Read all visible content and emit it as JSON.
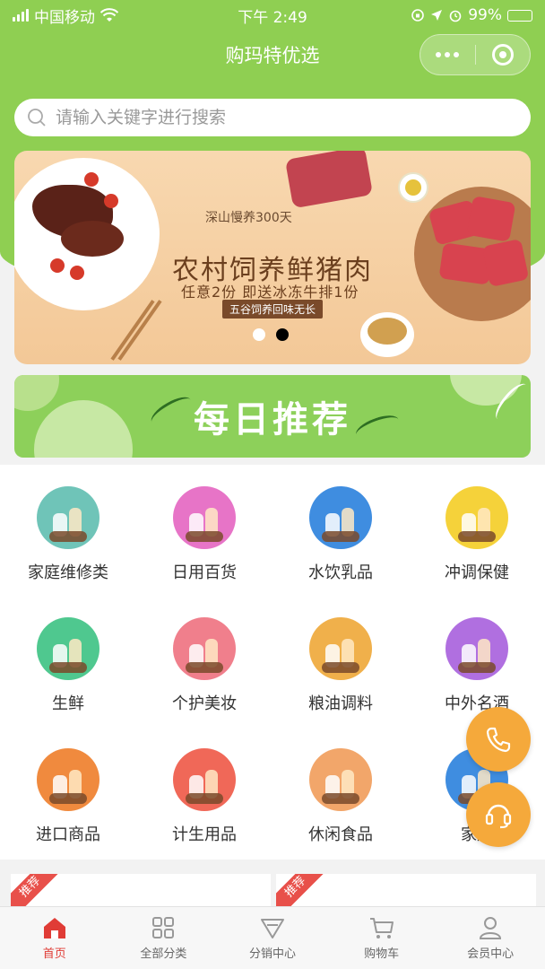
{
  "status_bar": {
    "carrier": "中国移动",
    "time": "下午 2:49",
    "battery": "99%"
  },
  "header": {
    "title": "购玛特优选"
  },
  "search": {
    "placeholder": "请输入关键字进行搜索"
  },
  "banner": {
    "subtitle": "深山慢养300天",
    "title": "农村饲养鲜猪肉",
    "offer": "任意2份 即送冰冻牛排1份",
    "tag": "五谷饲养回味无长",
    "active_slide": 2,
    "slide_count": 2
  },
  "daily": {
    "title": "每日推荐"
  },
  "categories": [
    {
      "label": "家庭维修类",
      "icon": "repairman-icon",
      "color": "#6fc4b8"
    },
    {
      "label": "日用百货",
      "icon": "household-goods-icon",
      "color": "#e774c7"
    },
    {
      "label": "水饮乳品",
      "icon": "drinks-icon",
      "color": "#3f8de0"
    },
    {
      "label": "冲调保健",
      "icon": "health-drinks-icon",
      "color": "#f5d23a"
    },
    {
      "label": "生鲜",
      "icon": "seafood-icon",
      "color": "#4fc88f"
    },
    {
      "label": "个护美妆",
      "icon": "cosmetics-icon",
      "color": "#f07f8c"
    },
    {
      "label": "粮油调料",
      "icon": "grain-oil-icon",
      "color": "#f0b04b"
    },
    {
      "label": "中外名酒",
      "icon": "liquor-icon",
      "color": "#b06fe0"
    },
    {
      "label": "进口商品",
      "icon": "imported-goods-icon",
      "color": "#f08a3e"
    },
    {
      "label": "计生用品",
      "icon": "family-planning-icon",
      "color": "#f06858"
    },
    {
      "label": "休闲食品",
      "icon": "snacks-icon",
      "color": "#f2a66a"
    },
    {
      "label": "家用",
      "icon": "home-appliance-icon",
      "color": "#3f8de0"
    }
  ],
  "recommend_badges": [
    "推荐",
    "推荐"
  ],
  "floating": {
    "phone_icon": "phone-icon",
    "service_icon": "customer-service-icon"
  },
  "tabs": [
    {
      "label": "首页",
      "icon": "home-icon",
      "active": true
    },
    {
      "label": "全部分类",
      "icon": "category-grid-icon",
      "active": false
    },
    {
      "label": "分销中心",
      "icon": "distribution-icon",
      "active": false
    },
    {
      "label": "购物车",
      "icon": "cart-icon",
      "active": false
    },
    {
      "label": "会员中心",
      "icon": "member-icon",
      "active": false
    }
  ],
  "colors": {
    "brand_green": "#8fcf52",
    "accent_red": "#e03c36",
    "float_orange": "#f5a93b"
  }
}
